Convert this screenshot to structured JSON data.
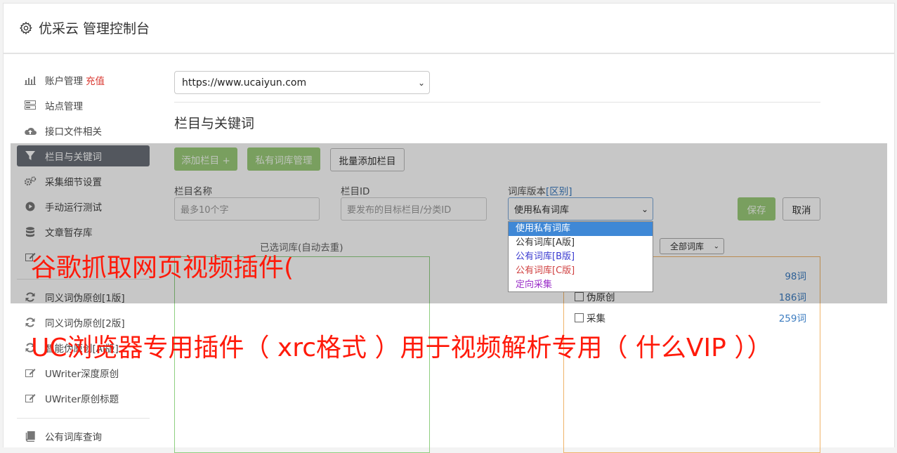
{
  "header": {
    "title": "优采云 管理控制台",
    "icon": "gear-icon"
  },
  "sidebar": {
    "items": [
      {
        "label": "账户管理",
        "badge": "充值",
        "icon": "bar-chart-icon"
      },
      {
        "label": "站点管理",
        "icon": "server-icon"
      },
      {
        "label": "接口文件相关",
        "icon": "cloud-upload-icon"
      },
      {
        "label": "栏目与关键词",
        "icon": "filter-icon",
        "active": true
      },
      {
        "label": "采集细节设置",
        "icon": "cogs-icon"
      },
      {
        "label": "手动运行测试",
        "icon": "play-icon"
      },
      {
        "label": "文章暂存库",
        "icon": "database-icon"
      },
      {
        "label": "同义词伪原创[1版]",
        "icon": "refresh-icon"
      },
      {
        "label": "同义词伪原创[2版]",
        "icon": "refresh-icon"
      },
      {
        "label": "智能伪原创[AI版]",
        "icon": "refresh-icon"
      },
      {
        "label": "UWriter深度原创",
        "icon": "edit-icon"
      },
      {
        "label": "UWriter原创标题",
        "icon": "edit-icon"
      },
      {
        "label": "公有词库查询",
        "icon": "book-icon"
      }
    ]
  },
  "site_select": {
    "value": "https://www.ucaiyun.com"
  },
  "section_title": "栏目与关键词",
  "toolbar": {
    "add_column": "添加栏目 +",
    "private_lib": "私有词库管理",
    "batch_add": "批量添加栏目"
  },
  "form": {
    "name_label": "栏目名称",
    "name_placeholder": "最多10个字",
    "id_label": "栏目ID",
    "id_placeholder": "要发布的目标栏目/分类ID",
    "version_label": "词库版本",
    "version_link": "[区别]",
    "version_value": "使用私有词库",
    "save": "保存",
    "cancel": "取消"
  },
  "version_options": [
    {
      "label": "使用私有词库",
      "color": "#ffffff"
    },
    {
      "label": "公有词库[A版]",
      "color": "#333333"
    },
    {
      "label": "公有词库[B版]",
      "color": "#3a3ad0"
    },
    {
      "label": "公有词库[C版]",
      "color": "#d04040"
    },
    {
      "label": "定向采集",
      "color": "#9b30c8"
    }
  ],
  "selected_lib_label": "已选词库(自动去重)",
  "lib_filter": "全部词库",
  "lib_list": [
    {
      "name": "",
      "count": "98词"
    },
    {
      "name": "伪原创",
      "count": "186词"
    },
    {
      "name": "采集",
      "count": "259词"
    }
  ],
  "watermark": {
    "line1": "谷歌抓取网页视频插件(",
    "line2": "UC浏览器专用插件（ xrc格式 ）用于视频解析专用（ 什么VIP ））"
  },
  "colors": {
    "accent_green": "#9ccc7a",
    "active_nav": "#6b7079",
    "recharge_red": "#d9372f",
    "watermark_red": "#ff1a0a"
  }
}
